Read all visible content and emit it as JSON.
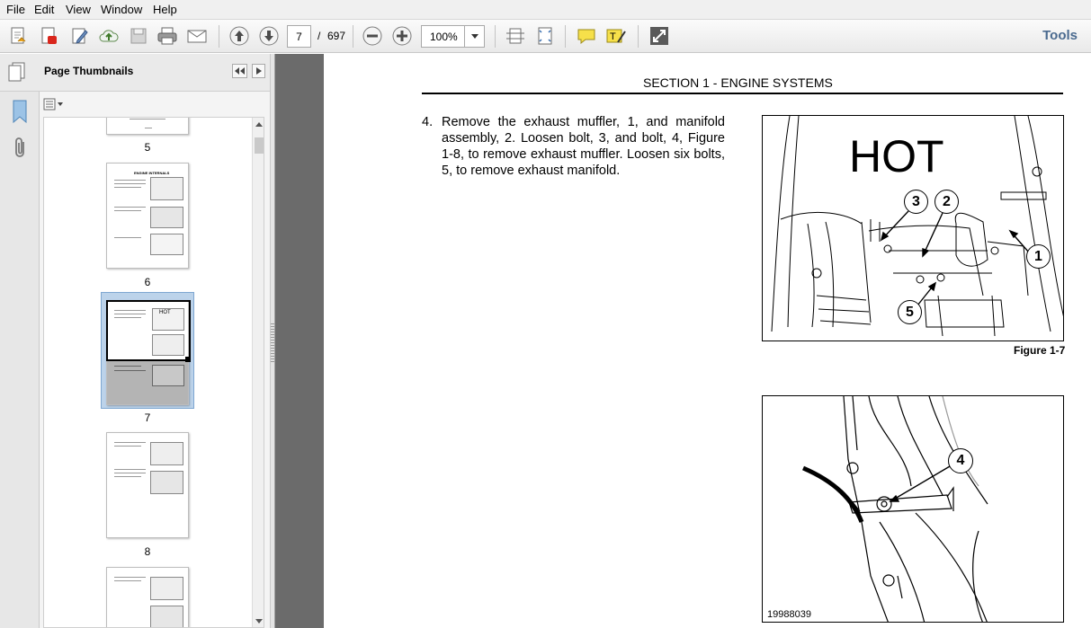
{
  "menu": [
    "File",
    "Edit",
    "View",
    "Window",
    "Help"
  ],
  "toolbar": {
    "page_current": "7",
    "page_sep": "/",
    "page_total": "697",
    "zoom": "100%",
    "tools_label": "Tools"
  },
  "panel": {
    "title": "Page Thumbnails",
    "thumbs": [
      "5",
      "6",
      "7",
      "8"
    ]
  },
  "document": {
    "section_header": "SECTION 1 - ENGINE SYSTEMS",
    "step_number": "4.",
    "step_text": "Remove the exhaust muffler, 1, and manifold assembly, 2. Loosen bolt, 3, and bolt, 4, Figure 1-8, to remove exhaust muffler. Loosen six bolts, 5, to remove exhaust manifold.",
    "figure1": {
      "hot_label": "HOT",
      "callouts": [
        "3",
        "2",
        "1",
        "5"
      ],
      "caption": "Figure 1-7"
    },
    "figure2": {
      "callout": "4",
      "image_id": "19988039"
    }
  },
  "thumb_texts": {
    "p6_title": "ENGINE INTERNALS",
    "p7_hot": "HOT"
  }
}
